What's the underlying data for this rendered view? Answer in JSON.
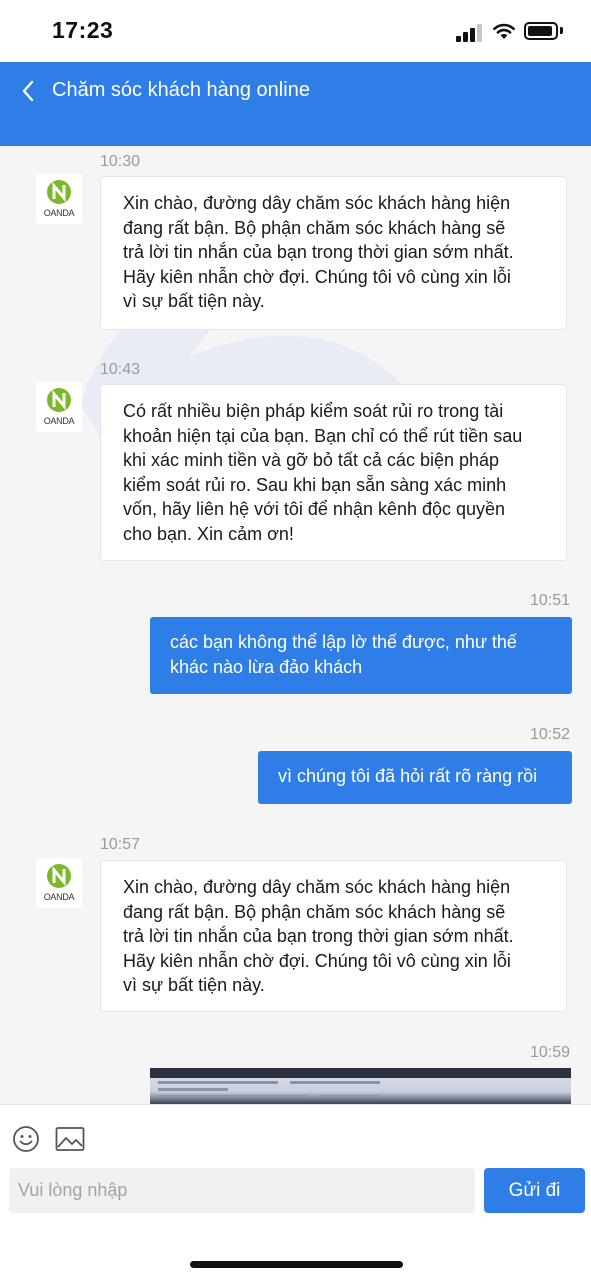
{
  "status_bar": {
    "time": "17:23"
  },
  "header": {
    "title": "Chăm sóc khách hàng online",
    "back_icon": "chevron-left-icon"
  },
  "agent": {
    "logo_text": "OANDA",
    "logo_color": "#7ab929"
  },
  "messages": [
    {
      "time": "10:30",
      "direction": "incoming",
      "lines": [
        "Xin chào, đường dây chăm sóc khách hàng hiện",
        "đang rất bận. Bộ phận chăm sóc khách hàng sẽ",
        "trả lời tin nhắn của bạn trong thời gian sớm nhất.",
        "Hãy kiên nhẫn chờ đợi. Chúng tôi vô cùng xin lỗi",
        "vì sự bất tiện này."
      ]
    },
    {
      "time": "10:43",
      "direction": "incoming",
      "lines": [
        "Có rất nhiều biện pháp kiểm soát rủi ro trong tài",
        "khoản hiện tại của bạn. Bạn chỉ có thể rút tiền sau",
        "khi xác minh tiền và gỡ bỏ tất cả các biện pháp",
        "kiểm soát rủi ro. Sau khi bạn sẵn sàng xác minh",
        "vốn, hãy liên hệ với tôi để nhận kênh độc quyền",
        "cho bạn. Xin cảm ơn!"
      ]
    },
    {
      "time": "10:51",
      "direction": "outgoing",
      "lines": [
        "các bạn không thể lập lờ thế được, như thế",
        "khác nào lừa đảo khách"
      ]
    },
    {
      "time": "10:52",
      "direction": "outgoing",
      "lines": [
        "vì chúng tôi đã hỏi rất rõ ràng rồi"
      ]
    },
    {
      "time": "10:57",
      "direction": "incoming",
      "lines": [
        "Xin chào, đường dây chăm sóc khách hàng hiện",
        "đang rất bận. Bộ phận chăm sóc khách hàng sẽ",
        "trả lời tin nhắn của bạn trong thời gian sớm nhất.",
        "Hãy kiên nhẫn chờ đợi. Chúng tôi vô cùng xin lỗi",
        "vì sự bất tiện này."
      ]
    },
    {
      "time": "10:59",
      "direction": "outgoing",
      "type": "image"
    }
  ],
  "composer": {
    "placeholder": "Vui lòng nhập",
    "send_label": "Gửi đi",
    "emoji_icon": "emoji-icon",
    "image_icon": "image-icon"
  },
  "colors": {
    "accent": "#2f7de7",
    "background": "#f5f5f6",
    "incoming_bubble": "#ffffff"
  }
}
